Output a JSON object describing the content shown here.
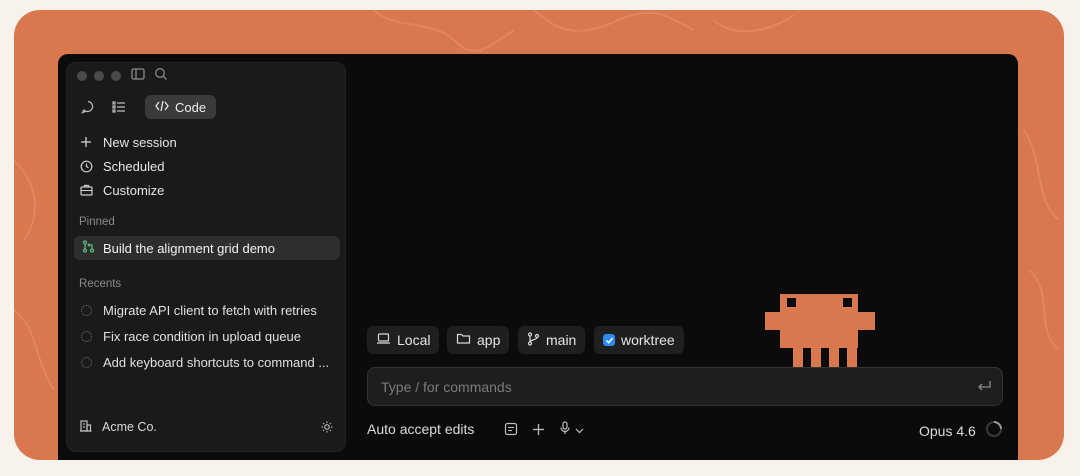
{
  "sidebar": {
    "code_tab_label": "Code",
    "nav": [
      {
        "icon": "plus-icon",
        "label": "New session"
      },
      {
        "icon": "clock-icon",
        "label": "Scheduled"
      },
      {
        "icon": "briefcase-icon",
        "label": "Customize"
      }
    ],
    "pinned_heading": "Pinned",
    "pinned_item": {
      "icon": "git-pull-request-icon",
      "label": "Build the alignment grid demo"
    },
    "recents_heading": "Recents",
    "recents": [
      {
        "label": "Migrate API client to fetch with retries"
      },
      {
        "label": "Fix race condition in upload queue"
      },
      {
        "label": "Add keyboard shortcuts to command ..."
      }
    ],
    "org_name": "Acme Co."
  },
  "context_chips": {
    "location": "Local",
    "folder": "app",
    "branch": "main",
    "worktree": "worktree",
    "worktree_checked": true
  },
  "composer": {
    "placeholder": "Type / for commands"
  },
  "footer": {
    "mode": "Auto accept edits",
    "model": "Opus 4.6"
  },
  "colors": {
    "frame": "#d9774f",
    "window": "#0b0b0b",
    "sidebar": "#1a1a1a",
    "mascot": "#d9774f",
    "checkbox": "#2b8bf2"
  }
}
